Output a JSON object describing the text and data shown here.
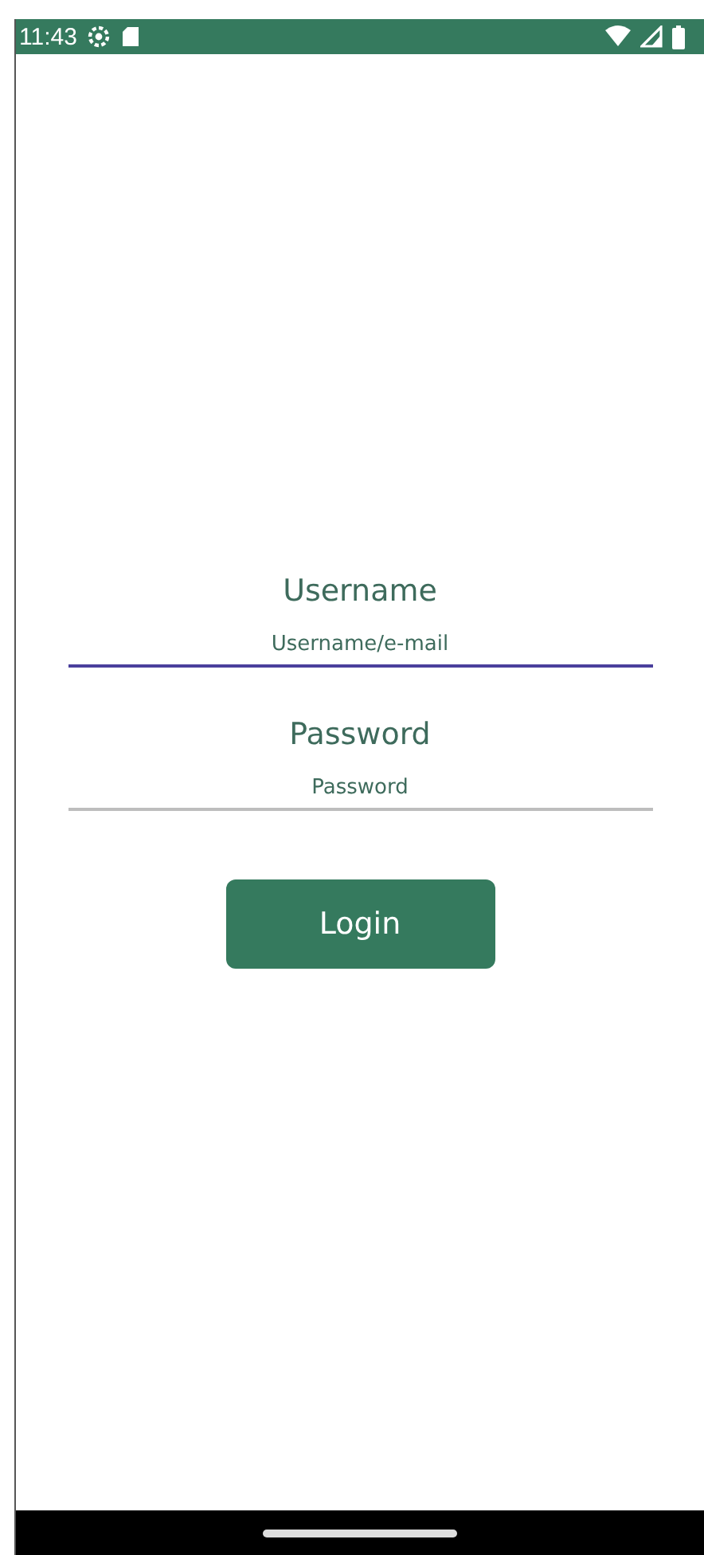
{
  "status_bar": {
    "time": "11:43"
  },
  "fields": [
    {
      "label": "Username",
      "placeholder": "Username/e-mail",
      "focused": true
    },
    {
      "label": "Password",
      "placeholder": "Password",
      "focused": false
    }
  ],
  "login_button": {
    "label": "Login"
  }
}
